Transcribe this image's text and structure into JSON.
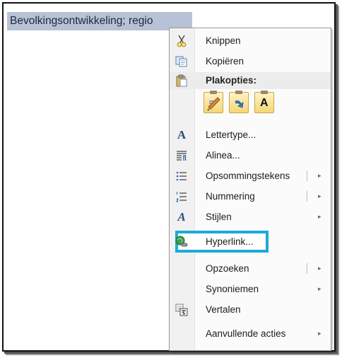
{
  "document": {
    "selected_text": "Bevolkingsontwikkeling; regio"
  },
  "context_menu": {
    "cut": {
      "label": "Knippen",
      "icon": "scissors-icon"
    },
    "copy": {
      "label": "Kopiëren",
      "icon": "copy-icon"
    },
    "paste_options": {
      "label": "Plakopties:",
      "icon": "paste-icon",
      "buttons": [
        {
          "name": "keep-source-formatting",
          "icon": "brush-paste-icon"
        },
        {
          "name": "merge-formatting",
          "icon": "merge-paste-icon"
        },
        {
          "name": "keep-text-only",
          "icon": "text-only-paste-icon",
          "glyph": "A"
        }
      ]
    },
    "font": {
      "label": "Lettertype...",
      "icon": "font-icon",
      "glyph": "A"
    },
    "paragraph": {
      "label": "Alinea...",
      "icon": "paragraph-icon"
    },
    "bullets": {
      "label": "Opsommingstekens",
      "icon": "bullets-icon",
      "submenu": true
    },
    "numbering": {
      "label": "Nummering",
      "icon": "numbering-icon",
      "submenu": true
    },
    "styles": {
      "label": "Stijlen",
      "icon": "styles-icon",
      "glyph": "A",
      "submenu": true
    },
    "hyperlink": {
      "label": "Hyperlink...",
      "icon": "hyperlink-icon",
      "highlighted": true,
      "highlight_color": "#1eaad6"
    },
    "lookup": {
      "label": "Opzoeken",
      "submenu": true
    },
    "synonyms": {
      "label": "Synoniemen",
      "submenu": true
    },
    "translate": {
      "label": "Vertalen",
      "icon": "translate-icon"
    },
    "additional_actions": {
      "label": "Aanvullende acties",
      "submenu": true
    },
    "submenu_arrow": "▸"
  }
}
